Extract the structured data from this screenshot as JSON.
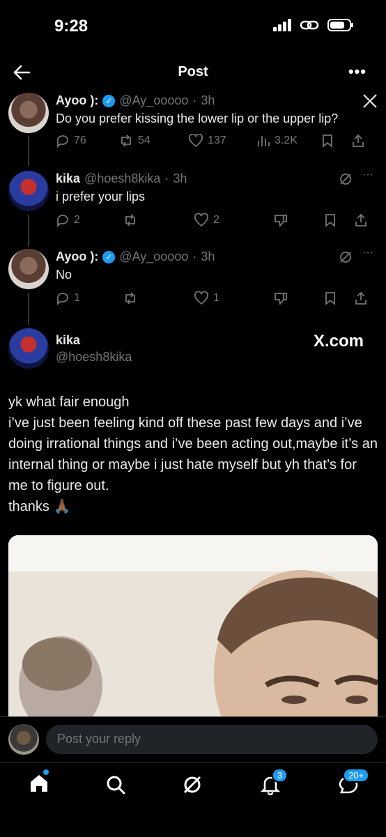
{
  "status_bar": {
    "time": "9:28"
  },
  "header": {
    "title": "Post"
  },
  "tweets": [
    {
      "name": "Ayoo ):",
      "handle": "@Ay_ooooo",
      "time": "3h",
      "text": "Do you prefer kissing the lower lip or the upper lip?",
      "replies": "76",
      "reposts": "54",
      "likes": "137",
      "views": "3.2K"
    },
    {
      "name": "kika",
      "handle": "@hoesh8kika",
      "time": "3h",
      "text": "i prefer your lips",
      "replies": "2",
      "reposts": "",
      "likes": "2"
    },
    {
      "name": "Ayoo ):",
      "handle": "@Ay_ooooo",
      "time": "3h",
      "text": "No",
      "replies": "1",
      "reposts": "",
      "likes": "1"
    }
  ],
  "main_post": {
    "name": "kika",
    "handle": "@hoesh8kika",
    "watermark": "X.com",
    "text": "yk what fair enough\ni’ve just been feeling kind off these past few days and i’ve doing irrational things and i’ve been acting out,maybe it’s an internal thing or maybe i just hate myself but yh that’s for me to figure out.\nthanks 🙏🏾"
  },
  "reply": {
    "placeholder": "Post your reply"
  },
  "tabbar": {
    "notifications_badge": "3",
    "messages_badge": "20+"
  },
  "colors": {
    "accent": "#1d9bf0",
    "background": "#000000",
    "muted": "#71767b"
  }
}
